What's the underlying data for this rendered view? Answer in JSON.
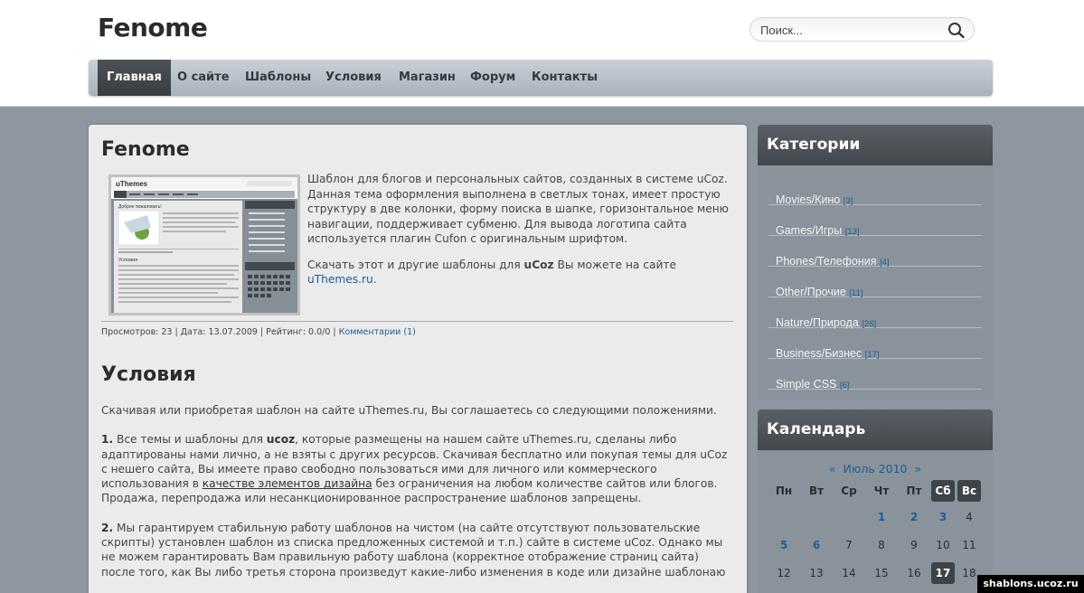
{
  "site": {
    "logo": "Fenome"
  },
  "search": {
    "placeholder": "Поиск..."
  },
  "nav": {
    "items": [
      {
        "label": "Главная",
        "active": true
      },
      {
        "label": "О сайте"
      },
      {
        "label": "Шаблоны"
      },
      {
        "label": "Условия"
      },
      {
        "label": "Магазин"
      },
      {
        "label": "Форум"
      },
      {
        "label": "Контакты"
      }
    ]
  },
  "post": {
    "title": "Fenome",
    "thumbnail_logo": "uThemes",
    "thumbnail_heading": "Доброе пожаловать!",
    "thumbnail_section": "Условия",
    "text1": "Шаблон для блогов и персональных сайтов, созданных в системе uCoz. Данная тема оформления выполнена в светлых тонах, имеет простую структуру в две колонки, форму поиска в шапке, горизонтальное меню навигации, поддерживает субменю. Для вывода логотипа сайта используется плагин Cufon с оригинальным шрифтом.",
    "text2_before": "Скачать этот и другие шаблоны для",
    "text2_ucoz": "uCoz",
    "text2_middle": "Вы можете на сайте",
    "text2_link": "uThemes.ru",
    "text2_after": ".",
    "meta_text": "Просмотров: 23 | Дата: 13.07.2009 | Рейтинг: 0.0/0 |",
    "meta_link": "Комментарии (1)"
  },
  "terms": {
    "title": "Условия",
    "intro": "Скачивая или приобретая шаблон на сайте uThemes.ru, Вы соглашаетесь со следующими положениями.",
    "p1_num": "1.",
    "p1_a": "Все темы и шаблоны для",
    "p1_ucoz": "ucoz",
    "p1_b": ", которые размещены на нашем сайте uThemes.ru, сделаны либо адаптированы нами лично, а не взяты с других ресурсов. Скачивая бесплатно или покупая темы для uCoz с нешего сайта, Вы имеете право свободно пользоваться ими для личного или коммерческого использования в",
    "p1_u": "качестве элементов дизайна",
    "p1_c": "без ограничения на любом количестве сайтов или блогов. Продажа, перепродажа или несанкционированное распространение шаблонов запрещены.",
    "p2_num": "2.",
    "p2": "Мы гарантируем стабильную работу шаблонов на чистом (на сайте отсутствуют пользовательские скрипты) установлен шаблон из списка предложенных системой и т.п.) сайте в системе uCoz. Однако мы не можем гарантировать Вам правильную работу шаблона (корректное отображение страниц сайта) после того, как Вы либо третья сторона произведут какие-либо изменения в коде или дизайне шаблонаю"
  },
  "categories": {
    "title": "Категории",
    "items": [
      {
        "label": "Movies/Кино",
        "count": "[3]"
      },
      {
        "label": "Games/Игры",
        "count": "[13]"
      },
      {
        "label": "Phones/Телефония",
        "count": "[4]"
      },
      {
        "label": "Other/Прочие",
        "count": "[11]"
      },
      {
        "label": "Nature/Природа",
        "count": "[26]"
      },
      {
        "label": "Business/Бизнес",
        "count": "[17]"
      },
      {
        "label": "Simple CSS",
        "count": "[6]"
      }
    ]
  },
  "calendar": {
    "title": "Календарь",
    "prev": "«",
    "month": "Июль 2010",
    "next": "»",
    "weekdays": [
      "Пн",
      "Вт",
      "Ср",
      "Чт",
      "Пт",
      "Сб",
      "Вс"
    ],
    "weeks": [
      [
        "",
        "",
        "",
        "1",
        "2",
        "3",
        "4"
      ],
      [
        "5",
        "6",
        "7",
        "8",
        "9",
        "10",
        "11"
      ],
      [
        "12",
        "13",
        "14",
        "15",
        "16",
        "17",
        "18"
      ]
    ],
    "linked_days": [
      "1",
      "2",
      "3",
      "5",
      "6"
    ],
    "today": "17"
  },
  "watermark": "shablons.ucoz.ru",
  "colors": {
    "link": "#1f5d95",
    "nav_active": "#3e4347",
    "sidebar_header": "#4a4f54"
  }
}
